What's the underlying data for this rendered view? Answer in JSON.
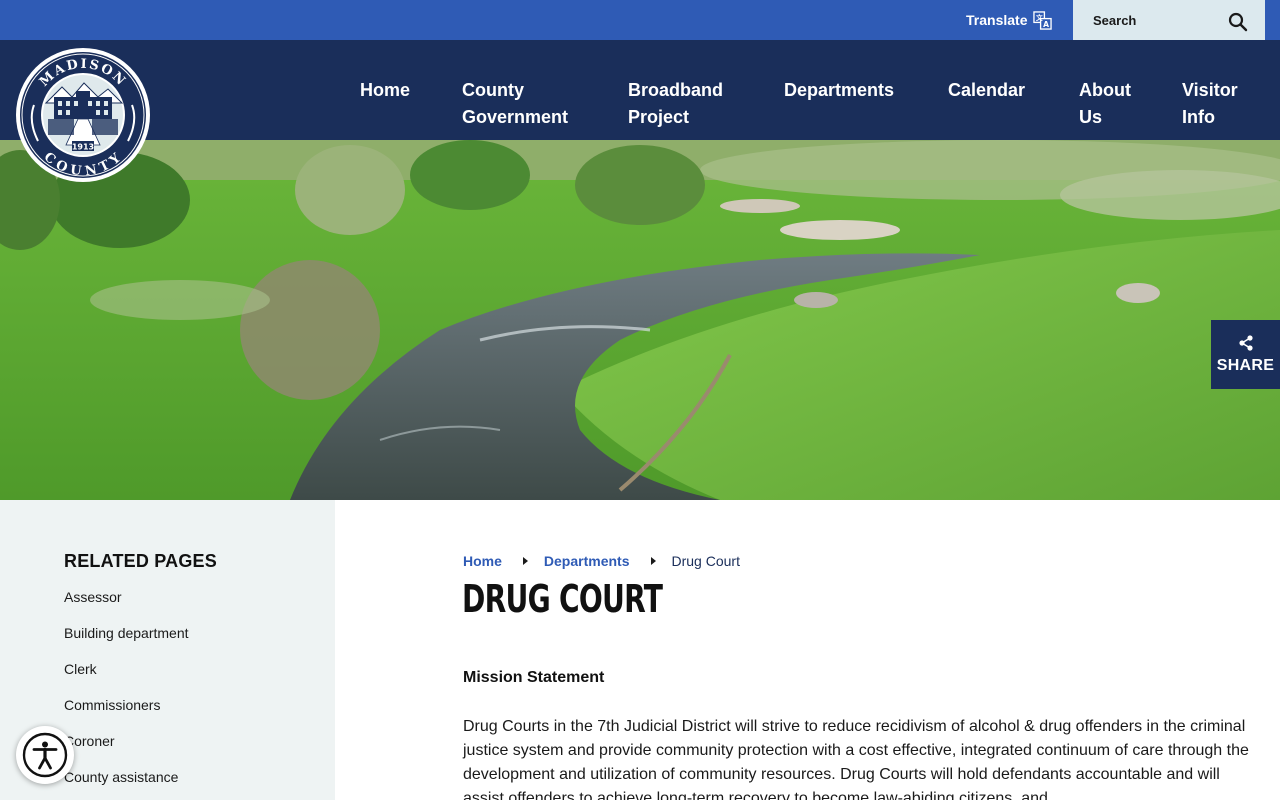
{
  "topbar": {
    "translate_label": "Translate",
    "search_placeholder": "Search"
  },
  "logo": {
    "top_text": "MADISON",
    "bottom_text": "COUNTY",
    "year": "1913"
  },
  "nav": {
    "items": [
      {
        "line1": "Home",
        "line2": ""
      },
      {
        "line1": "County",
        "line2": "Government"
      },
      {
        "line1": "Broadband",
        "line2": "Project"
      },
      {
        "line1": "Departments",
        "line2": ""
      },
      {
        "line1": "Calendar",
        "line2": ""
      },
      {
        "line1": "About",
        "line2": "Us"
      },
      {
        "line1": "Visitor",
        "line2": "Info"
      }
    ]
  },
  "share": {
    "label": "SHARE"
  },
  "sidebar": {
    "title": "RELATED PAGES",
    "items": [
      "Assessor",
      "Building department",
      "Clerk",
      "Commissioners",
      "Coroner",
      "County assistance"
    ]
  },
  "breadcrumb": {
    "home": "Home",
    "departments": "Departments",
    "current": "Drug Court"
  },
  "page": {
    "title": "DRUG COURT",
    "mission_heading": "Mission Statement",
    "mission_text": "Drug Courts in the 7th Judicial District will strive to reduce recidivism of alcohol & drug offenders in the criminal justice system and provide community protection with a cost effective, integrated continuum of care through the development and utilization of community resources. Drug Courts will hold defendants accountable and will assist offenders to achieve long-term recovery to become law-abiding citizens, and"
  },
  "colors": {
    "topbar": "#2f5bb5",
    "navbar": "#1a2e5a",
    "sidebar_bg": "#eef3f3",
    "link": "#2f5bb5"
  },
  "icons": {
    "translate": "translate-icon",
    "search": "search-icon",
    "share": "share-icon",
    "accessibility": "accessibility-icon"
  }
}
